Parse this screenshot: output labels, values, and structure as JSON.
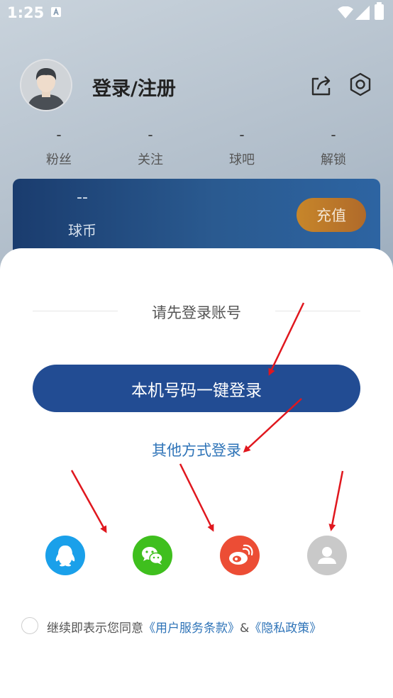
{
  "status_bar": {
    "time": "1:25"
  },
  "profile": {
    "title": "登录/注册"
  },
  "stats": [
    {
      "value": "-",
      "label": "粉丝"
    },
    {
      "value": "-",
      "label": "关注"
    },
    {
      "value": "-",
      "label": "球吧"
    },
    {
      "value": "-",
      "label": "解锁"
    }
  ],
  "coins": {
    "value": "--",
    "label": "球币",
    "recharge_label": "充值"
  },
  "login_sheet": {
    "prompt": "请先登录账号",
    "one_click_label": "本机号码一键登录",
    "other_methods_label": "其他方式登录",
    "social_icons": [
      "qq-icon",
      "wechat-icon",
      "weibo-icon",
      "guest-user-icon"
    ],
    "agreement": {
      "prefix": "继续即表示您同意",
      "terms_link": "《用户服务条款》",
      "separator": "&",
      "privacy_link": "《隐私政策》"
    }
  },
  "colors": {
    "primary_button": "#224c93",
    "link": "#2f74b8",
    "recharge": "#c7862a",
    "annotation_arrow": "#e0171e"
  }
}
